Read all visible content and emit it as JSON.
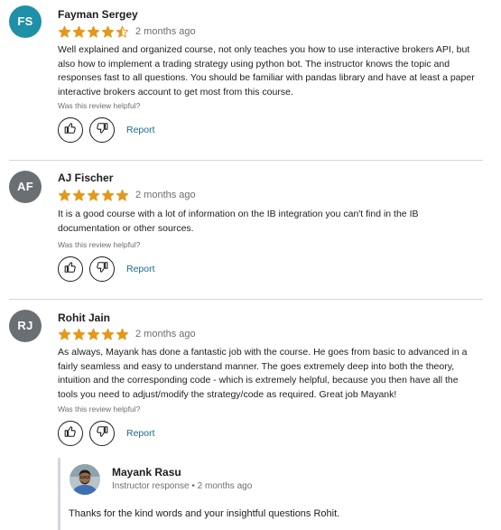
{
  "helpful_label": "Was this review helpful?",
  "report_label": "Report",
  "icons": {
    "like": "thumbs-up-icon",
    "dislike": "thumbs-down-icon",
    "star": "star-icon"
  },
  "colors": {
    "star": "#e59819",
    "link": "#1c6b8a",
    "divider": "#d1d7dc"
  },
  "reviews": [
    {
      "initials": "FS",
      "avatar_color": "#1e90a7",
      "name": "Fayman Sergey",
      "rating": 4.5,
      "date": "2 months ago",
      "text": "Well explained and organized course, not only teaches you how to use interactive brokers API, but also how to implement a trading strategy using python bot. The instructor knows the topic and responses fast to all questions. You should be familiar with pandas library and have at least a paper interactive brokers account to get most from this course."
    },
    {
      "initials": "AF",
      "avatar_color": "#6a6f73",
      "name": "AJ Fischer",
      "rating": 5,
      "date": "2 months ago",
      "text": "It is a good course with a lot of information on the IB integration you can't find in the IB documentation or other sources."
    },
    {
      "initials": "RJ",
      "avatar_color": "#6a6f73",
      "name": "Rohit Jain",
      "rating": 5,
      "date": "2 months ago",
      "text": "As always, Mayank has done a fantastic job with the course. He goes from basic to advanced in a fairly seamless and easy to understand manner. The goes extremely deep into both the theory, intuition and the corresponding code - which is extremely helpful, because you then have all the tools you need to adjust/modify the strategy/code as required. Great job Mayank!"
    }
  ],
  "instructor_response": {
    "name": "Mayank Rasu",
    "subtitle": "Instructor response • 2 months ago",
    "text": "Thanks for the kind words and your insightful questions Rohit."
  }
}
